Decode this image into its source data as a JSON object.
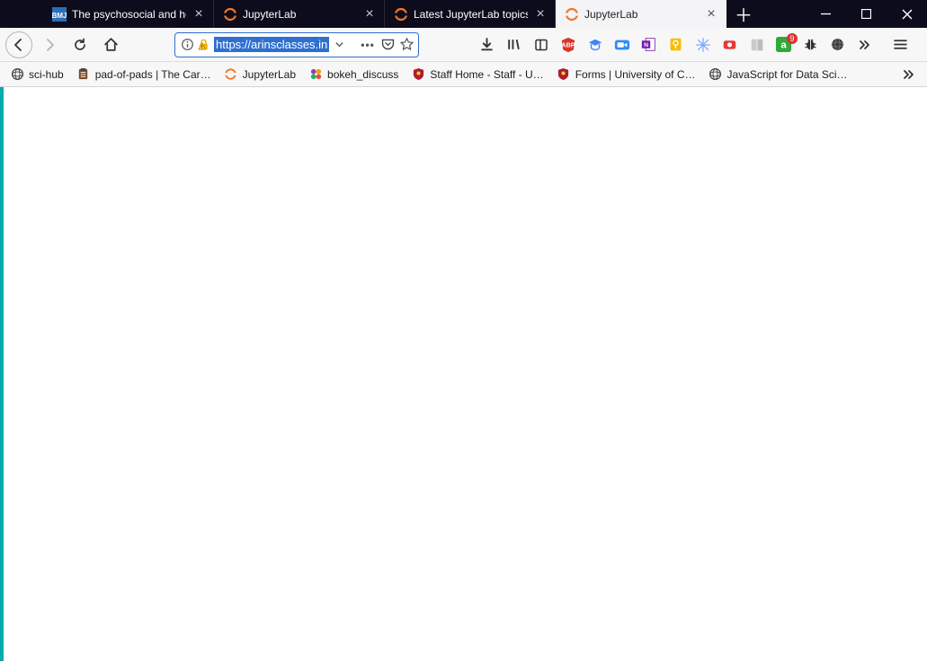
{
  "tabs": [
    {
      "title": "The psychosocial and health effects",
      "favicon": "bmj"
    },
    {
      "title": "JupyterLab",
      "favicon": "jupyter"
    },
    {
      "title": "Latest JupyterLab topics",
      "favicon": "jupyter"
    },
    {
      "title": "JupyterLab",
      "favicon": "jupyter",
      "active": true
    }
  ],
  "urlbar": {
    "url": "https://arinsclasses.in"
  },
  "toolbar_extensions": {
    "badge": "9"
  },
  "bookmarks": [
    {
      "label": "sci-hub",
      "icon": "globe"
    },
    {
      "label": "pad-of-pads | The Car…",
      "icon": "clipboard"
    },
    {
      "label": "JupyterLab",
      "icon": "jupyter"
    },
    {
      "label": "bokeh_discuss",
      "icon": "bokeh"
    },
    {
      "label": "Staff Home - Staff - U…",
      "icon": "shield-red"
    },
    {
      "label": "Forms | University of C…",
      "icon": "shield-red"
    },
    {
      "label": "JavaScript for Data Sci…",
      "icon": "globe"
    }
  ]
}
